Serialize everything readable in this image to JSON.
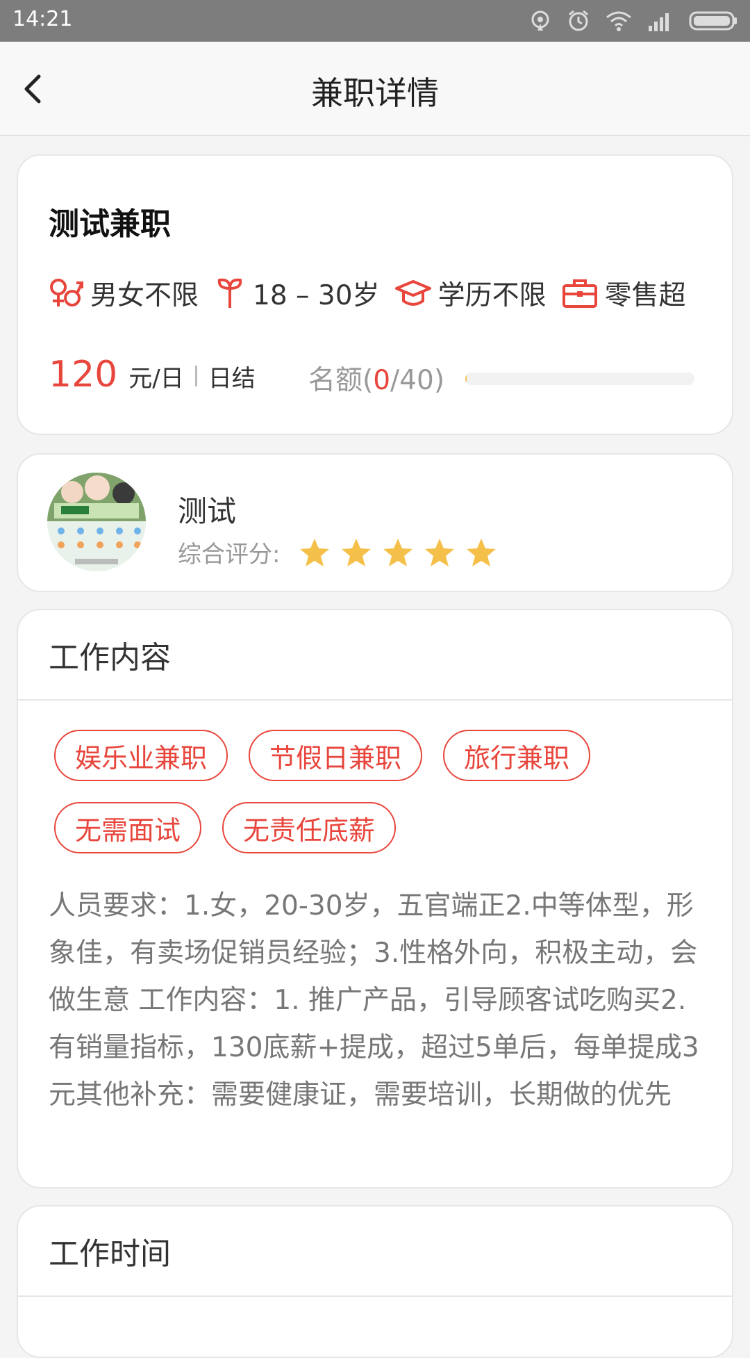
{
  "status_bar": {
    "time": "14:21"
  },
  "header": {
    "title": "兼职详情"
  },
  "job": {
    "title": "测试兼职",
    "attributes": [
      {
        "icon": "gender-icon",
        "label": "男女不限"
      },
      {
        "icon": "age-icon",
        "label": "18 – 30岁"
      },
      {
        "icon": "graduation-cap-icon",
        "label": "学历不限"
      },
      {
        "icon": "briefcase-icon",
        "label": "零售超"
      }
    ],
    "pay_amount": "120",
    "pay_unit": "元/日",
    "settlement": "日结",
    "quota_label": "名额(",
    "quota_filled": "0",
    "quota_total": "/40)",
    "quota_progress": 0.0
  },
  "employer": {
    "name": "测试",
    "rating_label": "综合评分:",
    "rating_stars": 5
  },
  "work_content": {
    "heading": "工作内容",
    "tags": [
      "娱乐业兼职",
      "节假日兼职",
      "旅行兼职",
      "无需面试",
      "无责任底薪"
    ],
    "description": "人员要求：1.女，20-30岁，五官端正2.中等体型，形象佳，有卖场促销员经验；3.性格外向，积极主动，会做生意 工作内容：1. 推广产品，引导顾客试吃购买2. 有销量指标，130底薪+提成，超过5单后，每单提成3元其他补充：需要健康证，需要培训，长期做的优先"
  },
  "work_time": {
    "heading": "工作时间"
  },
  "colors": {
    "accent": "#e8463c",
    "star": "#f5c04a",
    "status_bar": "#7d7d7d"
  }
}
